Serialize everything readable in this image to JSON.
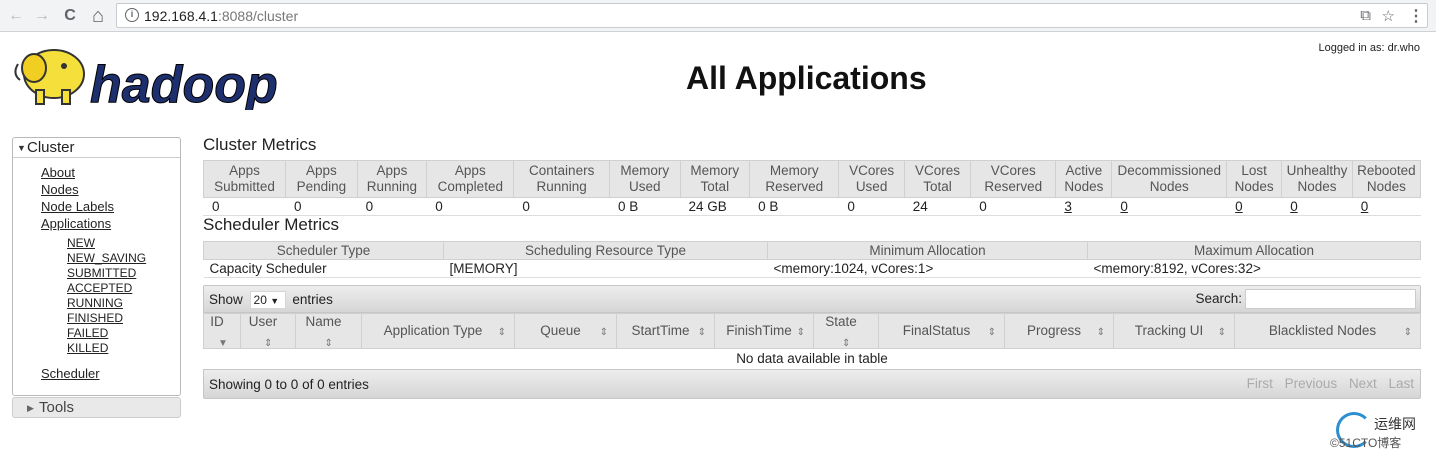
{
  "browser": {
    "url_host": "192.168.4.1",
    "url_rest": ":8088/cluster",
    "back_icon": "←",
    "forward_icon": "→",
    "reload_icon": "C",
    "home_icon": "⌂",
    "info_icon": "i",
    "translate_icon": "⧉",
    "star_icon": "☆",
    "menu_icon": "⋮"
  },
  "header": {
    "title": "All Applications",
    "logged_in": "Logged in as: dr.who",
    "logo_text": "hadoop"
  },
  "sidebar": {
    "cluster_label": "Cluster",
    "cluster_links": [
      "About",
      "Nodes",
      "Node Labels",
      "Applications"
    ],
    "app_states": [
      "NEW",
      "NEW_SAVING",
      "SUBMITTED",
      "ACCEPTED",
      "RUNNING",
      "FINISHED",
      "FAILED",
      "KILLED"
    ],
    "scheduler_label": "Scheduler",
    "tools_label": "Tools",
    "expand_icon": "▼",
    "collapse_icon": "▶"
  },
  "cluster_metrics": {
    "title": "Cluster Metrics",
    "headers": [
      [
        "Apps",
        "Submitted"
      ],
      [
        "Apps",
        "Pending"
      ],
      [
        "Apps",
        "Running"
      ],
      [
        "Apps",
        "Completed"
      ],
      [
        "Containers",
        "Running"
      ],
      [
        "Memory",
        "Used"
      ],
      [
        "Memory",
        "Total"
      ],
      [
        "Memory",
        "Reserved"
      ],
      [
        "VCores",
        "Used"
      ],
      [
        "VCores",
        "Total"
      ],
      [
        "VCores",
        "Reserved"
      ],
      [
        "Active",
        "Nodes"
      ],
      [
        "Decommissioned",
        "Nodes"
      ],
      [
        "Lost",
        "Nodes"
      ],
      [
        "Unhealthy",
        "Nodes"
      ],
      [
        "Rebooted",
        "Nodes"
      ]
    ],
    "values": [
      "0",
      "0",
      "0",
      "0",
      "0",
      "0 B",
      "24 GB",
      "0 B",
      "0",
      "24",
      "0",
      "3",
      "0",
      "0",
      "0",
      "0"
    ]
  },
  "scheduler_metrics": {
    "title": "Scheduler Metrics",
    "headers": [
      "Scheduler Type",
      "Scheduling Resource Type",
      "Minimum Allocation",
      "Maximum Allocation"
    ],
    "values": [
      "Capacity Scheduler",
      "[MEMORY]",
      "<memory:1024, vCores:1>",
      "<memory:8192, vCores:32>"
    ]
  },
  "apps_table": {
    "show_label": "Show",
    "page_size": "20",
    "entries_label": "entries",
    "search_label": "Search:",
    "columns": [
      [
        "ID"
      ],
      [
        "User"
      ],
      [
        "Name"
      ],
      [
        "Application Type"
      ],
      [
        "Queue"
      ],
      [
        "StartTime"
      ],
      [
        "FinishTime"
      ],
      [
        "State"
      ],
      [
        "FinalStatus"
      ],
      [
        "Progress"
      ],
      [
        "Tracking UI"
      ],
      [
        "Blacklisted Nodes"
      ]
    ],
    "sort_icon": "⇕",
    "sort_asc_icon": "▼",
    "empty_message": "No data available in table",
    "info": "Showing 0 to 0 of 0 entries",
    "pager": [
      "First",
      "Previous",
      "Next",
      "Last"
    ]
  },
  "watermark": {
    "line1": "运维网",
    "line2": "©51CTO博客"
  }
}
